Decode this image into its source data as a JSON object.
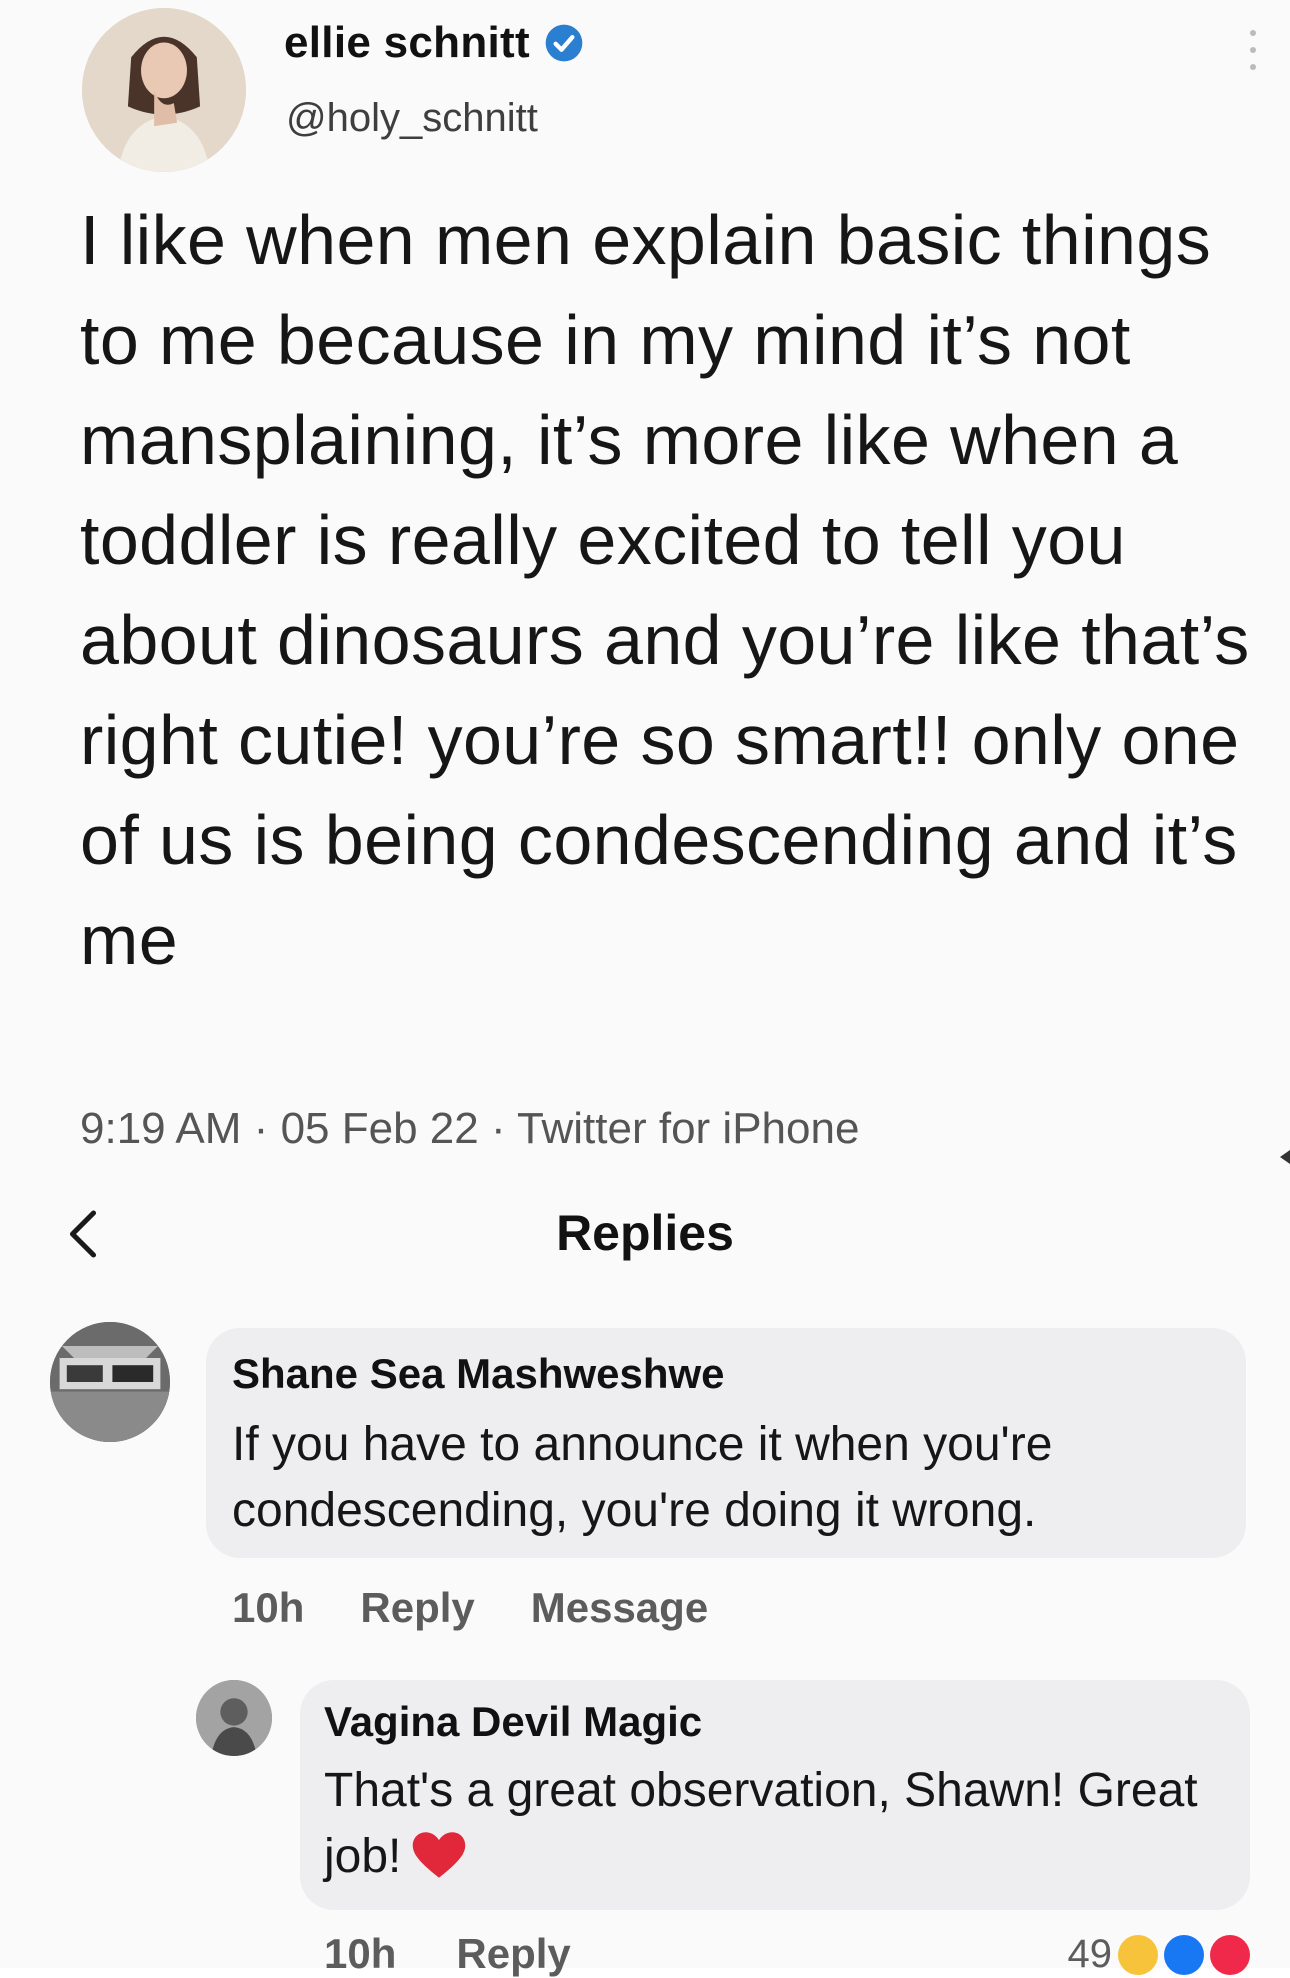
{
  "tweet": {
    "display_name": "ellie schnitt",
    "handle": "@holy_schnitt",
    "text": "I like when men explain basic things to me because in my mind it’s not mansplaining, it’s more like when a toddler is really excited to tell you about dinosaurs and you’re like that’s right cutie! you’re so smart!! only one of us is being condescending and it’s me",
    "time": "9:19 AM",
    "date": "05 Feb 22",
    "source": "Twitter for iPhone",
    "separator": "·",
    "verified_icon": "verified-check-icon",
    "verified_color": "#1d9bf0"
  },
  "replies_header": {
    "title": "Replies",
    "back_icon": "chevron-left-icon"
  },
  "comments": [
    {
      "author": "Shane Sea Mashweshwe",
      "text": "If you have to announce it when you're condescending, you're doing it wrong.",
      "age": "10h",
      "reply_label": "Reply",
      "message_label": "Message"
    },
    {
      "author": "Vagina Devil Magic",
      "text": "That's a great observation, Shawn! Great job!",
      "emoji_icon": "red-heart-icon",
      "age": "10h",
      "reply_label": "Reply",
      "reaction_count": "49",
      "reaction_icons": [
        "haha-icon",
        "like-icon",
        "love-icon"
      ]
    }
  ],
  "colors": {
    "bubble": "#eeeef0",
    "heart": "#e0283a",
    "muted_text": "#5c5c5c"
  }
}
